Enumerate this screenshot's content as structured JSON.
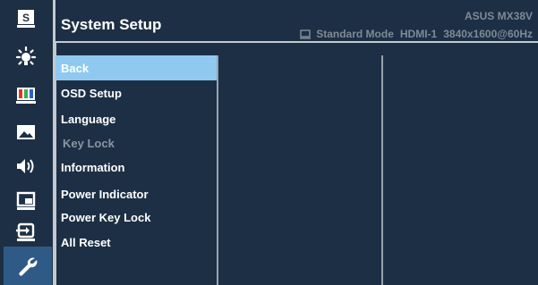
{
  "header": {
    "title": "System Setup",
    "brand_model": "ASUS  MX38V",
    "mode": "Standard Mode",
    "input": "HDMI-1",
    "resolution": "3840x1600@60Hz",
    "mode_icon": "monitor-icon"
  },
  "sidebar": {
    "items": [
      {
        "icon": "splendid-icon",
        "label": "S"
      },
      {
        "icon": "brightness-icon"
      },
      {
        "icon": "color-icon"
      },
      {
        "icon": "image-icon"
      },
      {
        "icon": "sound-icon"
      },
      {
        "icon": "pip-icon"
      },
      {
        "icon": "input-select-icon"
      },
      {
        "icon": "wrench-icon",
        "active": true
      }
    ]
  },
  "menu": {
    "items": [
      {
        "label": "Back",
        "state": "selected"
      },
      {
        "label": "OSD Setup"
      },
      {
        "label": "Language"
      },
      {
        "label": "Key Lock",
        "state": "disabled"
      },
      {
        "label": "Information"
      },
      {
        "label": "Power Indicator"
      },
      {
        "label": "Power Key Lock"
      },
      {
        "label": "All Reset"
      }
    ]
  },
  "colors": {
    "background": "#1d2f45",
    "selected": "#8fc9f0",
    "separator": "#c4c9cf",
    "muted_text": "#7f8a96"
  }
}
